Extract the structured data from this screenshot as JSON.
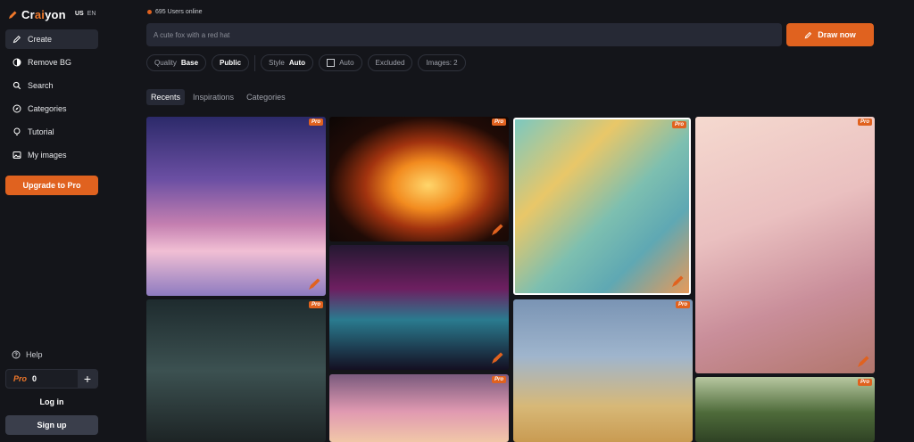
{
  "brand": {
    "name_prefix": "Cr",
    "name_accent": "ai",
    "name_suffix": "yon",
    "lang_us": "US",
    "lang_en": "EN"
  },
  "sidebar": {
    "items": [
      {
        "label": "Create",
        "icon": "pencil-icon",
        "active": true
      },
      {
        "label": "Remove BG",
        "icon": "contrast-icon"
      },
      {
        "label": "Search",
        "icon": "search-icon"
      },
      {
        "label": "Categories",
        "icon": "compass-icon"
      },
      {
        "label": "Tutorial",
        "icon": "bulb-icon"
      },
      {
        "label": "My images",
        "icon": "image-icon"
      }
    ],
    "upgrade_label": "Upgrade to Pro",
    "help_label": "Help",
    "credits_pro": "Pro",
    "credits_count": "0",
    "credits_plus": "+",
    "login_label": "Log in",
    "signup_label": "Sign up"
  },
  "header": {
    "online_text": "695 Users online",
    "prompt_placeholder": "A cute fox with a red hat",
    "draw_label": "Draw now"
  },
  "options": {
    "quality_label": "Quality",
    "quality_value": "Base",
    "public_label": "Public",
    "style_label": "Style",
    "style_value": "Auto",
    "ratio_label": "Auto",
    "excluded_label": "Excluded",
    "images_label": "Images: 2"
  },
  "tabs": [
    "Recents",
    "Inspirations",
    "Categories"
  ],
  "gallery": {
    "badge": "Pro"
  },
  "colors": {
    "accent": "#e0621f",
    "background": "#14151a",
    "panel": "#262935"
  }
}
